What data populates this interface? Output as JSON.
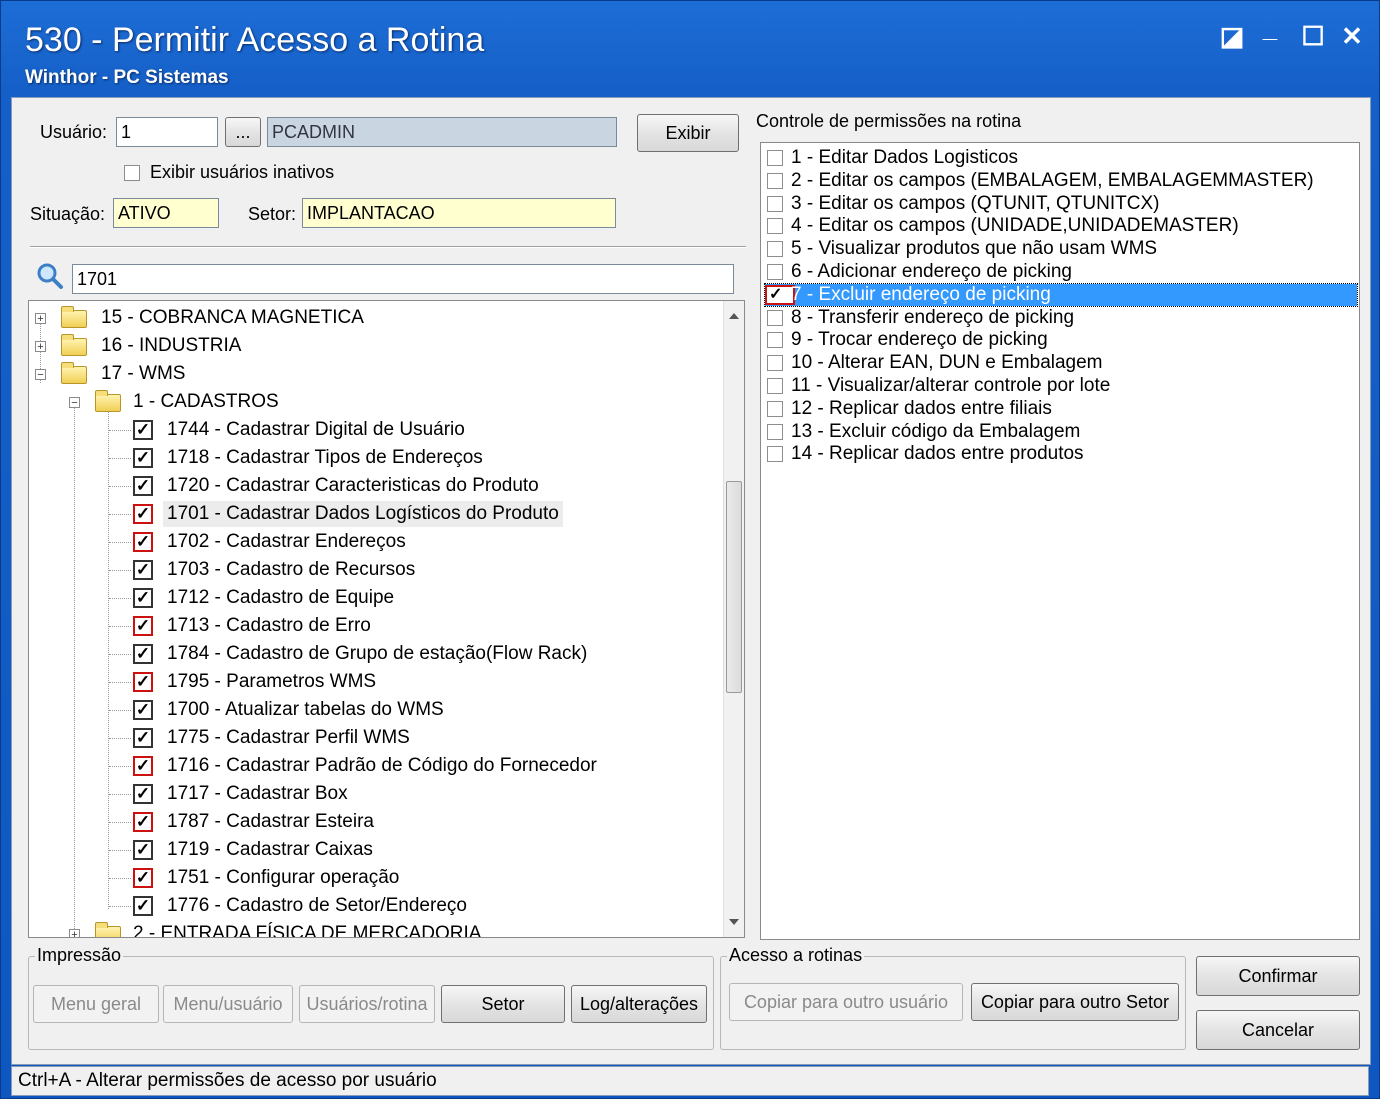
{
  "window": {
    "title": "530 - Permitir Acesso a Rotina",
    "subtitle": "Winthor - PC Sistemas",
    "restore_glyph": "◪",
    "minimize_glyph": "_",
    "maximize_glyph": "☐",
    "close_glyph": "✕"
  },
  "form": {
    "usuario_label": "Usuário:",
    "usuario_value": "1",
    "lookup_label": "...",
    "usuario_name": "PCADMIN",
    "exibir_label": "Exibir",
    "inativos_label": "Exibir usuários inativos",
    "situacao_label": "Situação:",
    "situacao_value": "ATIVO",
    "setor_label": "Setor:",
    "setor_value": "IMPLANTACAO",
    "search_value": "1701"
  },
  "tree": {
    "top": [
      {
        "label": "15 - COBRANCA MAGNETICA"
      },
      {
        "label": "16 - INDUSTRIA"
      },
      {
        "label": "17 - WMS"
      }
    ],
    "group": "1 - CADASTROS",
    "items": [
      {
        "label": "1744 - Cadastrar Digital de Usuário",
        "red": false
      },
      {
        "label": "1718 - Cadastrar Tipos de Endereços",
        "red": false
      },
      {
        "label": "1720 - Cadastrar Caracteristicas do Produto",
        "red": false
      },
      {
        "label": "1701 - Cadastrar Dados Logísticos do Produto",
        "red": true
      },
      {
        "label": "1702 - Cadastrar Endereços",
        "red": true
      },
      {
        "label": "1703 - Cadastro de Recursos",
        "red": false
      },
      {
        "label": "1712 - Cadastro de Equipe",
        "red": false
      },
      {
        "label": "1713 - Cadastro de Erro",
        "red": true
      },
      {
        "label": "1784 - Cadastro de Grupo de estação(Flow Rack)",
        "red": false
      },
      {
        "label": "1795 - Parametros WMS",
        "red": true
      },
      {
        "label": "1700 - Atualizar tabelas do WMS",
        "red": false
      },
      {
        "label": "1775 - Cadastrar Perfil WMS",
        "red": false
      },
      {
        "label": "1716 - Cadastrar Padrão de Código do Fornecedor",
        "red": true
      },
      {
        "label": "1717 - Cadastrar Box",
        "red": false
      },
      {
        "label": "1787 - Cadastrar Esteira",
        "red": true
      },
      {
        "label": "1719 - Cadastrar Caixas",
        "red": false
      },
      {
        "label": "1751 - Configurar operação",
        "red": true
      },
      {
        "label": "1776 - Cadastro de Setor/Endereço",
        "red": false
      }
    ],
    "next": "2 - ENTRADA FÍSICA DE MERCADORIA",
    "check_glyph": "✓"
  },
  "permissions": {
    "title": "Controle de permissões na rotina",
    "items": [
      {
        "label": "1 - Editar Dados Logisticos",
        "checked": false
      },
      {
        "label": "2 - Editar os campos (EMBALAGEM, EMBALAGEMMASTER)",
        "checked": false
      },
      {
        "label": "3 - Editar os campos (QTUNIT, QTUNITCX)",
        "checked": false
      },
      {
        "label": "4 - Editar os campos (UNIDADE,UNIDADEMASTER)",
        "checked": false
      },
      {
        "label": "5 - Visualizar produtos que não usam WMS",
        "checked": false
      },
      {
        "label": "6 - Adicionar endereço de picking",
        "checked": false
      },
      {
        "label": "7 - Excluir endereço de picking",
        "checked": true
      },
      {
        "label": "8 - Transferir endereço de picking",
        "checked": false
      },
      {
        "label": "9 - Trocar endereço de picking",
        "checked": false
      },
      {
        "label": "10 - Alterar EAN, DUN e Embalagem",
        "checked": false
      },
      {
        "label": "11 - Visualizar/alterar controle por lote",
        "checked": false
      },
      {
        "label": "12 - Replicar dados entre filiais",
        "checked": false
      },
      {
        "label": "13 - Excluir código da Embalagem",
        "checked": false
      },
      {
        "label": "14 - Replicar dados entre produtos",
        "checked": false
      }
    ]
  },
  "impressao": {
    "title": "Impressão",
    "menu_geral": "Menu geral",
    "menu_usuario": "Menu/usuário",
    "usuarios_rotina": "Usuários/rotina",
    "setor": "Setor",
    "log": "Log/alterações"
  },
  "acesso": {
    "title": "Acesso a rotinas",
    "copiar_usuario": "Copiar para outro usuário",
    "copiar_setor": "Copiar para outro Setor"
  },
  "actions": {
    "confirmar": "Confirmar",
    "cancelar": "Cancelar"
  },
  "status": "Ctrl+A - Alterar permissões de acesso por usuário",
  "colors": {
    "title_blue": "#1560c8",
    "selection": "#3399ff",
    "required_yellow": "#ffffd0",
    "red_check": "#cc1111"
  }
}
